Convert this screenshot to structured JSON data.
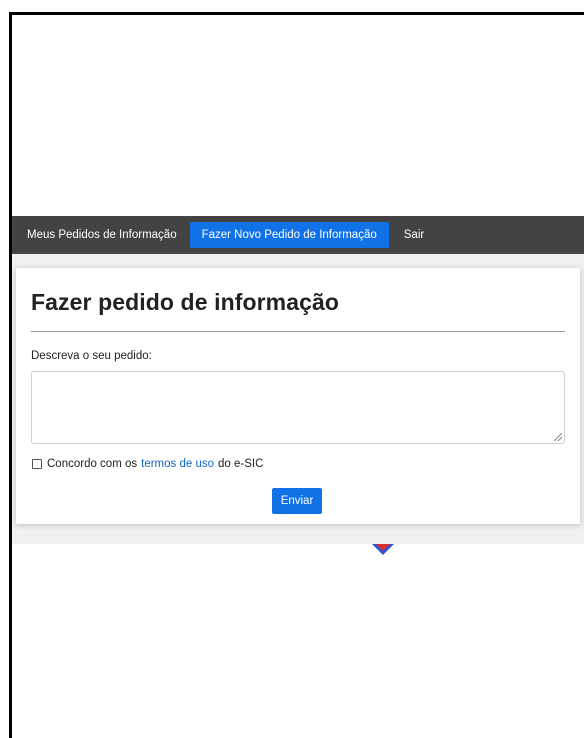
{
  "nav": {
    "items": [
      {
        "label": "Meus Pedidos de Informação",
        "active": false
      },
      {
        "label": "Fazer Novo Pedido de Informação",
        "active": true
      },
      {
        "label": "Sair",
        "active": false
      }
    ]
  },
  "form": {
    "title": "Fazer pedido de informação",
    "description_label": "Descreva o seu pedido:",
    "description_value": "",
    "terms": {
      "checked": false,
      "prefix": "Concordo com os",
      "link_text": "termos de uso",
      "suffix": "do e-SIC"
    },
    "submit_label": "Enviar"
  },
  "colors": {
    "navbar": "#434343",
    "accent": "#1172e8",
    "link": "#1166cc"
  }
}
